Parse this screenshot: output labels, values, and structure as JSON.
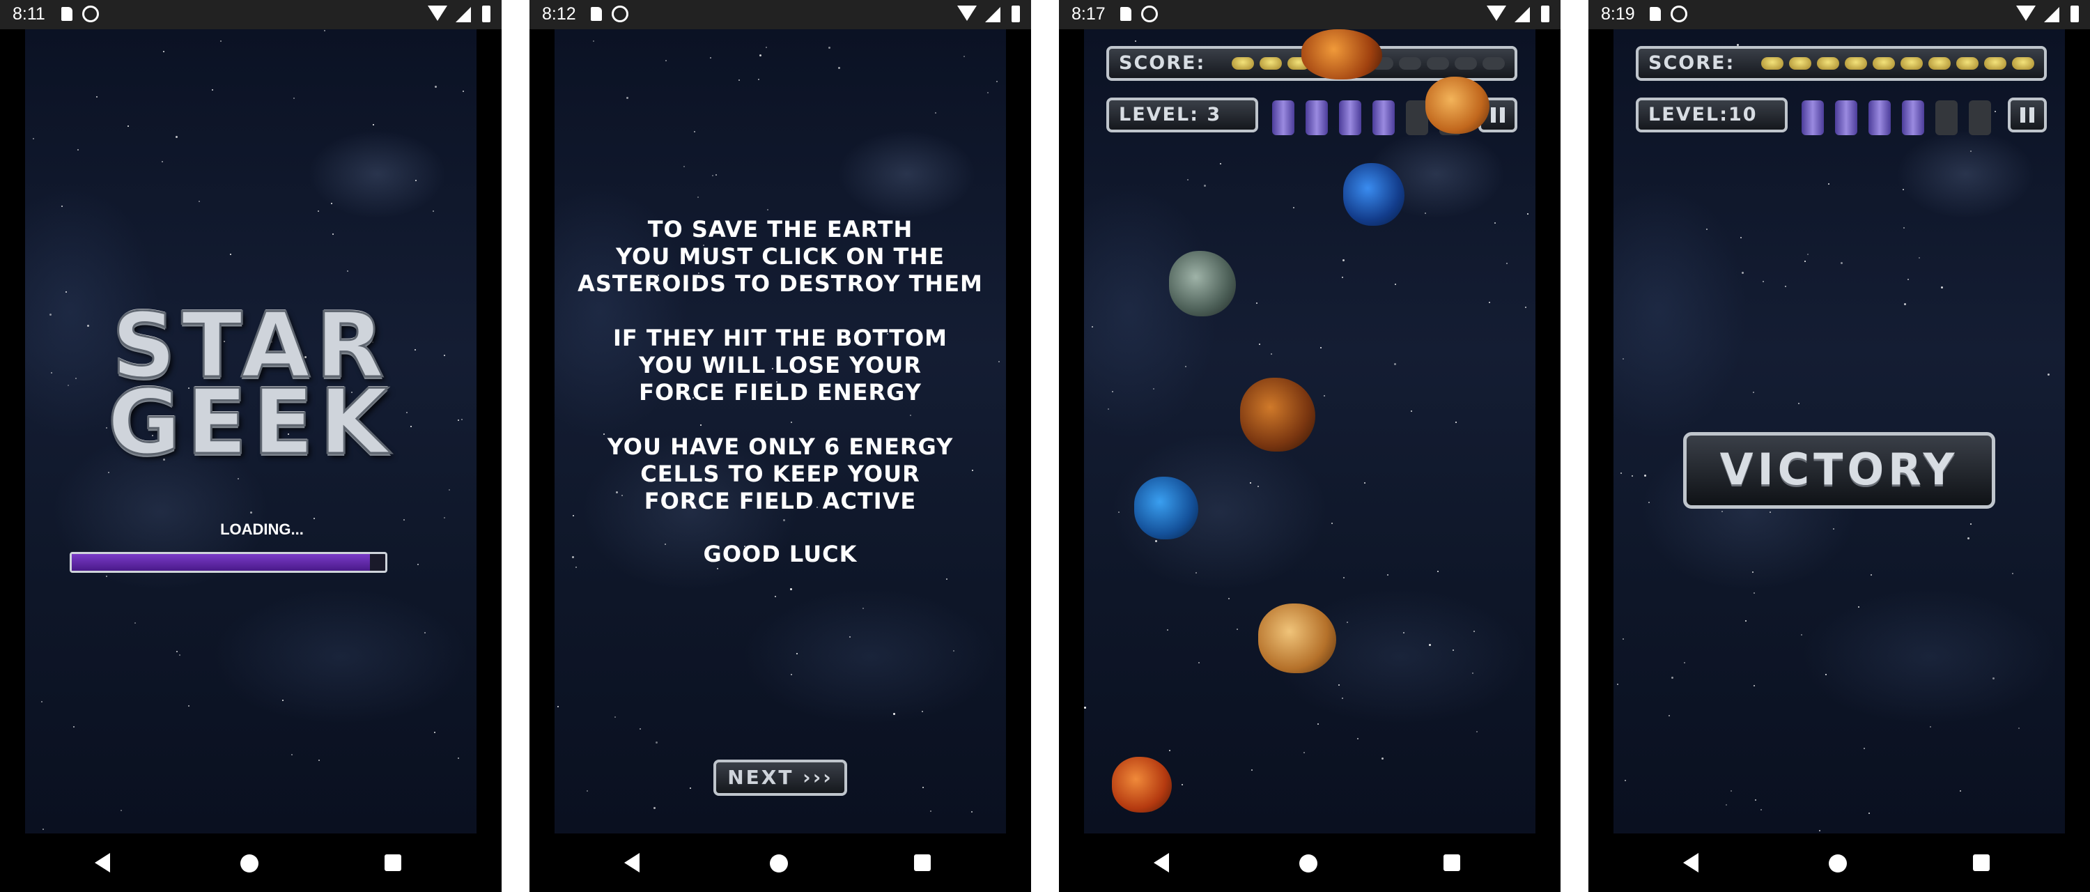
{
  "screens": [
    {
      "status_time": "8:11",
      "logo_line1": "STAR",
      "logo_line2": "GEEK",
      "loading_label": "LOADING...",
      "loading_progress": 0.95
    },
    {
      "status_time": "8:12",
      "paragraph1": [
        "TO SAVE THE EARTH",
        "YOU MUST CLICK ON THE",
        "ASTEROIDS TO DESTROY THEM"
      ],
      "paragraph2": [
        "IF THEY HIT THE BOTTOM",
        "YOU WILL LOSE YOUR",
        "FORCE FIELD ENERGY"
      ],
      "paragraph3": [
        "YOU HAVE ONLY 6 ENERGY",
        "CELLS TO KEEP YOUR",
        "FORCE FIELD ACTIVE"
      ],
      "good_luck": "GOOD LUCK",
      "next_label": "NEXT ›››"
    },
    {
      "status_time": "8:17",
      "score_label": "SCORE:",
      "score_coins_filled": 3,
      "score_coins_total": 10,
      "level_label": "LEVEL: 3",
      "energy_cells_active": 4,
      "energy_cells_total": 6,
      "asteroids": [
        "orange",
        "amber",
        "blue",
        "gray",
        "copper",
        "blue",
        "gold",
        "red"
      ]
    },
    {
      "status_time": "8:19",
      "score_label": "SCORE:",
      "score_coins_filled": 10,
      "score_coins_total": 10,
      "level_label": "LEVEL:10",
      "energy_cells_active": 4,
      "energy_cells_total": 6,
      "victory_label": "VICTORY"
    }
  ],
  "colors": {
    "background_space": "#0f1729",
    "progress_purple": "#6a2fb5",
    "energy_purple": "#7a6ad0",
    "coin_gold": "#d8c25a",
    "metal": "#cfd4db"
  }
}
